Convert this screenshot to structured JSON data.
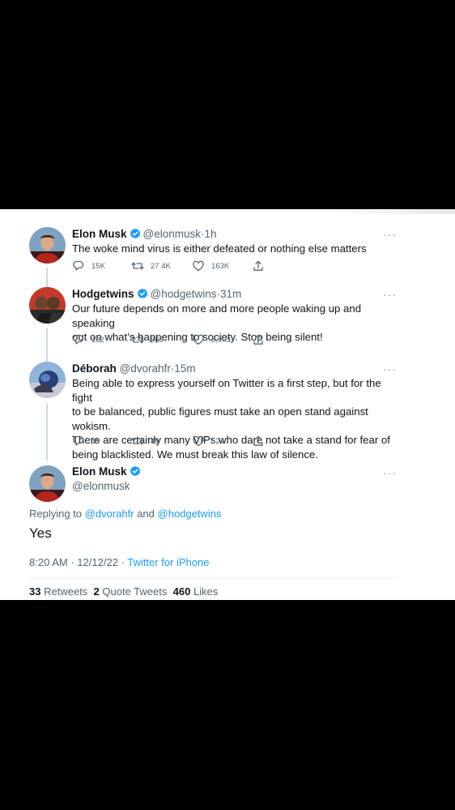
{
  "colors": {
    "accent": "#1d9bf0",
    "text": "#0f1419",
    "secondary": "#536471",
    "background": "#ffffff",
    "letterbox": "#000000"
  },
  "tweets": [
    {
      "name": "Elon Musk",
      "handle": "@elonmusk",
      "time": "1h",
      "text": [
        "The woke mind virus is either defeated or nothing else matters"
      ],
      "reply_count": "15K",
      "retweet_count": "27.4K",
      "like_count": "163K",
      "verified": true
    },
    {
      "name": "Hodgetwins",
      "handle": "@hodgetwins",
      "time": "31m",
      "text": [
        "Our future depends on more and more people waking up and speaking",
        "out on what’s happening to society. Stop being silent!"
      ],
      "reply_count": "132",
      "retweet_count": "369",
      "like_count": "3,903",
      "verified": true
    },
    {
      "name": "Déborah",
      "handle": "@dvorahfr",
      "time": "15m",
      "text": [
        "Being able to express yourself on Twitter is a first step, but for the fight",
        "to be balanced, public figures must take an open stand against wokism.",
        "There are certainly many VIPs who dare not take a stand for fear of",
        "being blacklisted. We must break this law of silence."
      ],
      "reply_count": "19",
      "retweet_count": "49",
      "like_count": "524",
      "verified": false
    }
  ],
  "main_tweet": {
    "name": "Elon Musk",
    "handle": "@elonmusk",
    "replying_prefix": "Replying to",
    "replying_to_1": "@dvorahfr",
    "replying_and": "and",
    "replying_to_2": "@hodgetwins",
    "text": "Yes",
    "time": "8:20 AM",
    "date": "12/12/22",
    "separator": "·",
    "source": "Twitter for iPhone",
    "retweets_count": "33",
    "retweets_label": "Retweets",
    "quote_count": "2",
    "quote_label": "Quote Tweets",
    "likes_count": "460",
    "likes_label": "Likes"
  },
  "icons": {
    "reply": "reply-icon",
    "retweet": "retweet-icon",
    "like": "heart-icon",
    "share": "share-icon",
    "more": "more-icon",
    "verified": "verified-badge-icon"
  },
  "more_label": "···",
  "dot": "·"
}
